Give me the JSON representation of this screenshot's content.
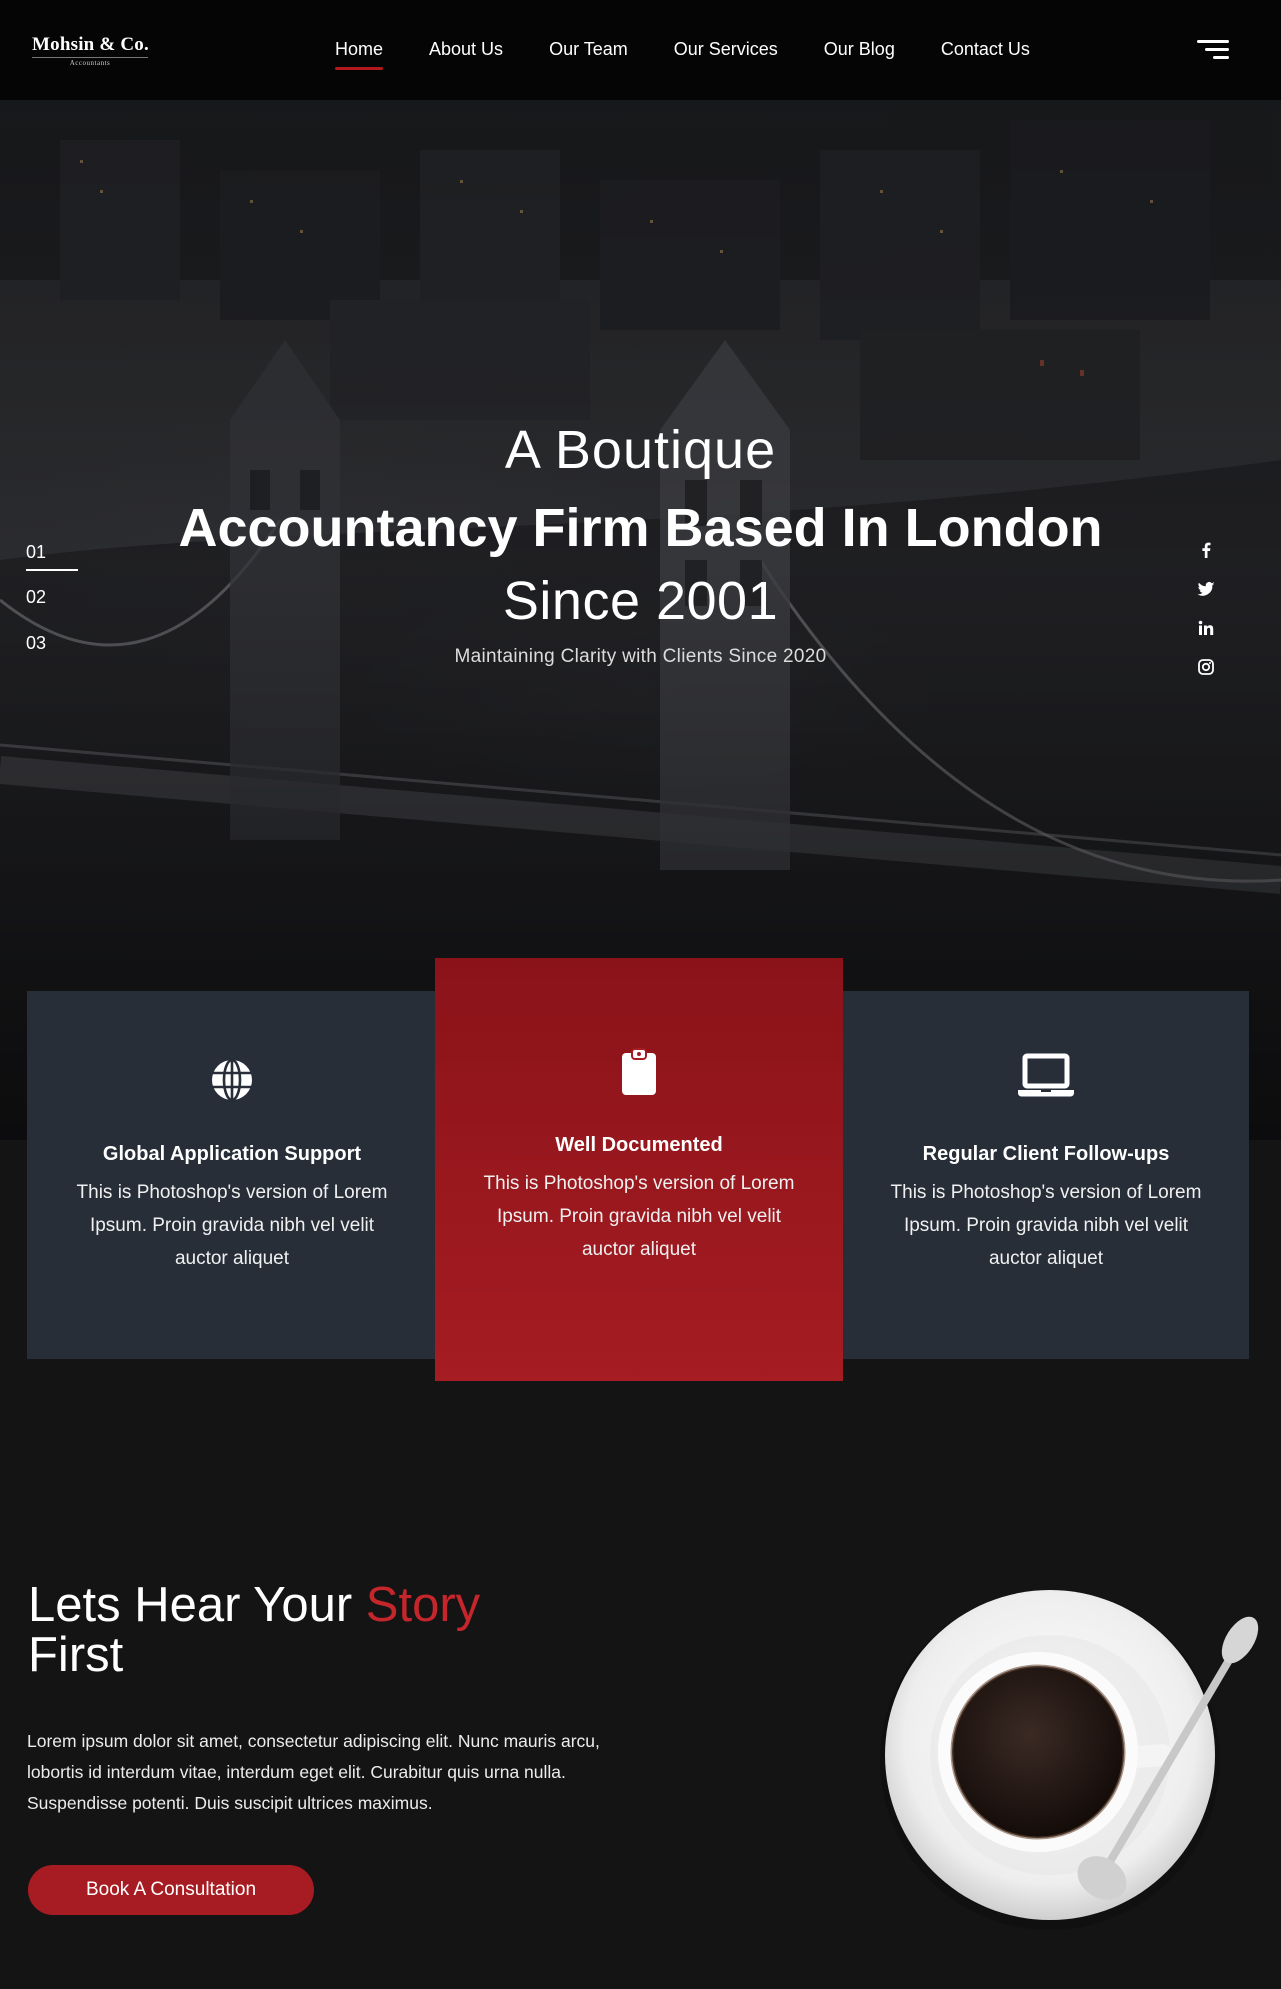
{
  "brand": {
    "name": "Mohsin & Co.",
    "tagline": "Accountants"
  },
  "nav": {
    "items": [
      {
        "label": "Home",
        "active": true
      },
      {
        "label": "About Us",
        "active": false
      },
      {
        "label": "Our Team",
        "active": false
      },
      {
        "label": "Our Services",
        "active": false
      },
      {
        "label": "Our Blog",
        "active": false
      },
      {
        "label": "Contact Us",
        "active": false
      }
    ],
    "menu_icon": "hamburger-icon"
  },
  "hero": {
    "line1": "A Boutique",
    "line2": "Accountancy Firm Based In London",
    "line3": "Since 2001",
    "subtitle": "Maintaining Clarity with Clients Since 2020",
    "slides": [
      "01",
      "02",
      "03"
    ],
    "active_slide": "01",
    "social_icons": [
      "facebook-icon",
      "twitter-icon",
      "linkedin-icon",
      "instagram-icon"
    ]
  },
  "features": [
    {
      "icon": "globe-icon",
      "title": "Global Application Support",
      "body": "This is Photoshop's version of Lorem Ipsum. Proin gravida nibh vel velit auctor aliquet"
    },
    {
      "icon": "clipboard-icon",
      "title": "Well Documented",
      "body": "This is Photoshop's version of Lorem Ipsum. Proin gravida nibh vel velit auctor aliquet"
    },
    {
      "icon": "laptop-icon",
      "title": "Regular Client Follow-ups",
      "body": "This is Photoshop's version of Lorem Ipsum. Proin gravida nibh vel velit auctor aliquet"
    }
  ],
  "story": {
    "title_part1": "Lets Hear Your ",
    "title_accent": "Story",
    "title_part2": "First",
    "body": "Lorem ipsum dolor sit amet, consectetur adipiscing elit. Nunc mauris arcu, lobortis id interdum vitae, interdum eget elit. Curabitur quis urna nulla. Suspendisse potenti. Duis suscipit ultrices maximus.",
    "cta_label": "Book A Consultation"
  },
  "colors": {
    "accent": "#b3181e",
    "card_dark": "#272e38",
    "card_red": "#a51c22",
    "background": "#141414"
  }
}
